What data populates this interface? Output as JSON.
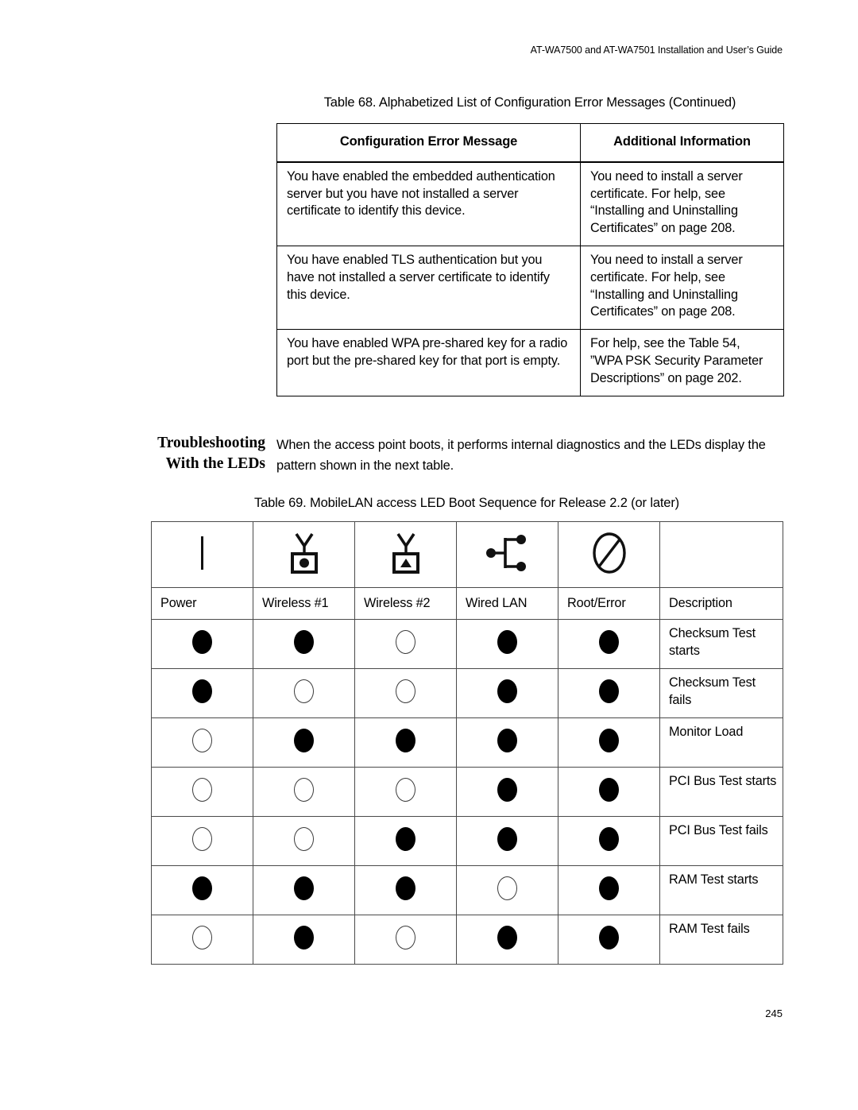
{
  "page": {
    "running_header": "AT-WA7500 and AT-WA7501 Installation and User’s Guide",
    "page_number": "245"
  },
  "table68": {
    "caption": "Table 68. Alphabetized List of Configuration Error Messages (Continued)",
    "columns": [
      "Configuration Error Message",
      "Additional Information"
    ],
    "rows": [
      {
        "message": "You have enabled the embedded authentication server but you have not installed a server certificate to identify this device.",
        "info": "You need to install a server certificate. For help, see “Installing and Uninstalling Certificates” on page 208."
      },
      {
        "message": "You have enabled TLS authentication but you have not installed a server certificate to identify this device.",
        "info": "You need to install a server certificate. For help, see “Installing and Uninstalling Certificates” on page 208."
      },
      {
        "message": "You have enabled WPA pre-shared key for a radio port but the pre-shared key for that port is empty.",
        "info": "For help, see the Table 54, ”WPA PSK Security Parameter Descriptions” on page 202."
      }
    ]
  },
  "section": {
    "heading_line1": "Troubleshooting",
    "heading_line2": "With the LEDs",
    "body": "When the access point boots, it performs internal diagnostics and the LEDs display the pattern shown in the next table."
  },
  "table69": {
    "caption": "Table 69. MobileLAN access LED Boot Sequence for Release 2.2 (or later)",
    "icons": [
      "power-bar-icon",
      "antenna-circle-icon",
      "antenna-triangle-icon",
      "wired-lan-network-icon",
      "circle-slash-error-icon",
      ""
    ],
    "columns": [
      "Power",
      "Wireless #1",
      "Wireless #2",
      "Wired LAN",
      "Root/Error",
      "Description"
    ],
    "legend": {
      "on": "LED on (filled)",
      "off": "LED off (unfilled)"
    },
    "rows": [
      {
        "leds": [
          "on",
          "on",
          "off",
          "on",
          "on"
        ],
        "description": "Checksum Test starts"
      },
      {
        "leds": [
          "on",
          "off",
          "off",
          "on",
          "on"
        ],
        "description": "Checksum Test fails"
      },
      {
        "leds": [
          "off",
          "on",
          "on",
          "on",
          "on"
        ],
        "description": "Monitor Load"
      },
      {
        "leds": [
          "off",
          "off",
          "off",
          "on",
          "on"
        ],
        "description": "PCI Bus Test starts"
      },
      {
        "leds": [
          "off",
          "off",
          "on",
          "on",
          "on"
        ],
        "description": "PCI Bus Test fails"
      },
      {
        "leds": [
          "on",
          "on",
          "on",
          "off",
          "on"
        ],
        "description": "RAM Test starts"
      },
      {
        "leds": [
          "off",
          "on",
          "off",
          "on",
          "on"
        ],
        "description": "RAM Test fails"
      }
    ]
  },
  "colors": {
    "text": "#000000",
    "rule": "#4a4a4a",
    "led_on": "#000000",
    "led_off": "#ffffff"
  }
}
